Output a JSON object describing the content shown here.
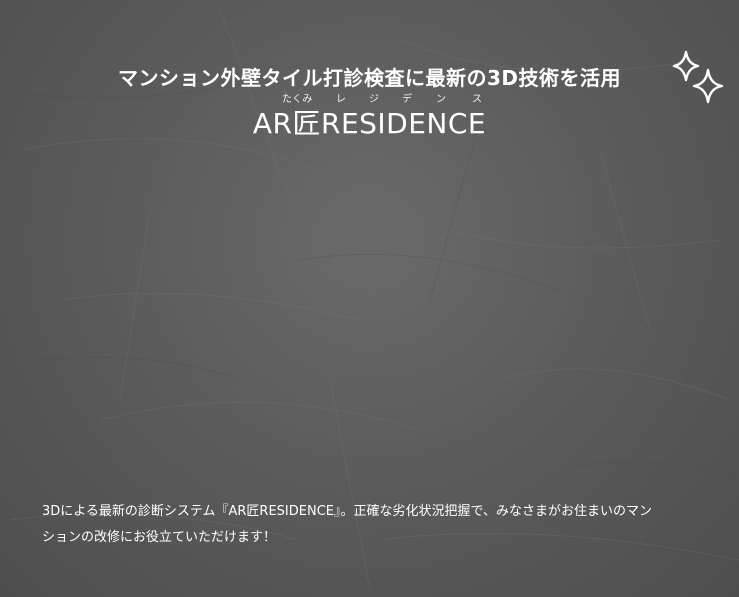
{
  "hero": {
    "subtitle": "マンション外壁タイル打診検査に最新の3D技術を活用",
    "ruby": [
      "たくみ",
      "レ",
      "ジ",
      "デ",
      "ン",
      "ス"
    ],
    "brand_title": "AR匠RESIDENCE"
  },
  "description": {
    "line1": "3Dによる最新の診断システム『AR匠RESIDENCE』。正確な劣化状況把握で、みなさまがお住まいのマン",
    "line2": "ションの改修にお役立ていただけます！"
  },
  "icons": {
    "sparkles": "sparkles-icon"
  },
  "colors": {
    "background": "#5a5a5a",
    "text": "#ffffff"
  }
}
